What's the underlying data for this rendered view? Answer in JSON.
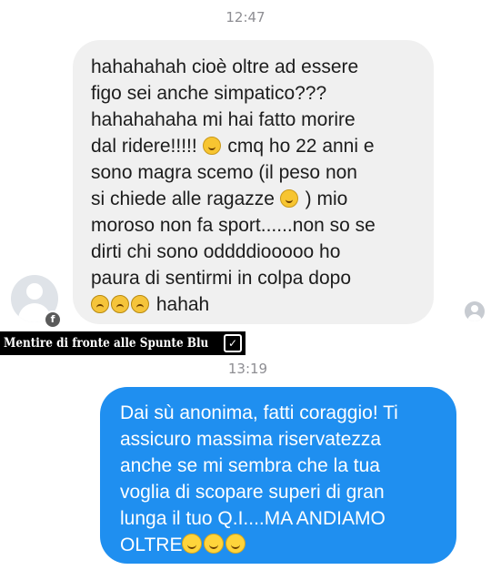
{
  "conversation": {
    "timestamp_1": "12:47",
    "timestamp_2": "13:19",
    "incoming": {
      "line_1": "hahahahah cioè oltre ad essere",
      "line_2": "figo sei anche simpatico???",
      "line_3": "hahahahaha mi hai fatto morire",
      "line_4_start": "dal ridere!!!!!",
      "line_4_end": "cmq ho 22 anni e",
      "line_5": "sono magra scemo (il peso non",
      "line_6_start": "si chiede alle ragazze",
      "line_6_end": ") mio",
      "line_7": "moroso non fa sport......non so se",
      "line_8": "dirti chi sono oddddiooooo ho",
      "line_9": "paura di sentirmi in colpa dopo",
      "line_10_end": "hahah"
    },
    "outgoing": {
      "line_1": "Dai sù anonima, fatti coraggio! Ti",
      "line_2": "assicuro massima riservatezza",
      "line_3": "anche se mi sembra che la tua",
      "line_4": "voglia di scopare superi di gran",
      "line_5": "lunga il tuo Q.I....MA ANDIAMO",
      "line_6": "OLTRE"
    }
  },
  "avatar": {
    "badge": "f"
  },
  "watermark": {
    "text": "Mentire di fronte alle Spunte Blu"
  },
  "icons": {
    "laugh": "face-with-tears-of-joy-icon",
    "tongue": "face-with-tongue-icon",
    "anxious": "anxious-face-icon",
    "grin": "grinning-face-icon",
    "check": "check-box-icon"
  },
  "colors": {
    "incoming_bubble": "#f0f0f0",
    "outgoing_bubble": "#1f8ff0",
    "watermark_bg": "#000000"
  }
}
